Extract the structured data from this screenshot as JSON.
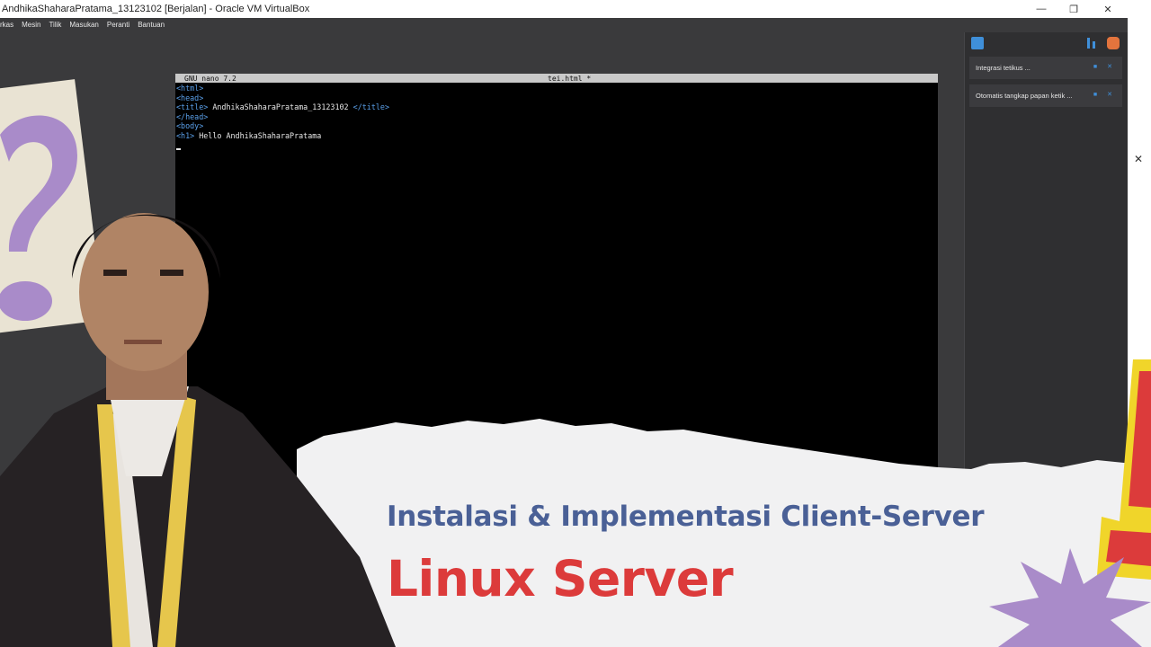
{
  "window": {
    "title": "AndhikaShaharaPratama_13123102 [Berjalan] - Oracle VM VirtualBox",
    "minimize_icon": "minimize-icon",
    "maximize_icon": "restore-icon",
    "close_icon": "close-icon"
  },
  "menu": {
    "items": [
      "rkas",
      "Mesin",
      "Tilik",
      "Masukan",
      "Peranti",
      "Bantuan"
    ]
  },
  "terminal": {
    "app": "GNU nano 7.2",
    "filename": "tei.html *",
    "lines": [
      {
        "tag": "<html>",
        "text": ""
      },
      {
        "tag": "<head>",
        "text": ""
      },
      {
        "tag": "<title>",
        "text": " AndhikaShaharaPratama_13123102 ",
        "close": "</title>"
      },
      {
        "tag": "</head>",
        "text": ""
      },
      {
        "tag": "<body>",
        "text": ""
      },
      {
        "tag": "<h1>",
        "text": " Hello AndhikaShaharaPratama"
      }
    ]
  },
  "side_panel": {
    "icons": [
      "chat-icon",
      "sort-icon",
      "mouse-integration-icon"
    ],
    "notifications": [
      {
        "label": "Integrasi tetikus ..."
      },
      {
        "label": "Otomatis tangkap papan ketik ..."
      }
    ]
  },
  "overlay": {
    "subtitle": "Instalasi & Implementasi Client-Server",
    "headline": "Linux Server"
  },
  "colors": {
    "subtitle": "#4a6096",
    "headline": "#dc3b3b",
    "accent_yellow": "#f0d52a",
    "accent_purple": "#a07cc5"
  }
}
